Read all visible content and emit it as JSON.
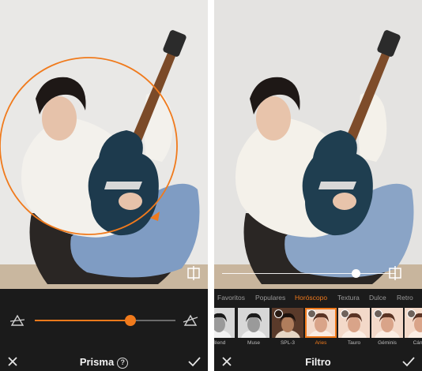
{
  "left_panel": {
    "title": "Prisma",
    "help_glyph": "?",
    "slider_value": 0.68,
    "effect_color": "#f07a1c",
    "icons": [
      "prism-less-icon",
      "prism-more-icon",
      "close-icon",
      "help-icon",
      "check-icon"
    ]
  },
  "right_panel": {
    "title": "Filtro",
    "intensity_value": 0.77,
    "categories": [
      {
        "label": "Favoritos",
        "active": false
      },
      {
        "label": "Populares",
        "active": false
      },
      {
        "label": "Horóscopo",
        "active": true
      },
      {
        "label": "Textura",
        "active": false
      },
      {
        "label": "Dulce",
        "active": false
      },
      {
        "label": "Retro",
        "active": false
      }
    ],
    "filters": [
      {
        "label": "Blend",
        "selected": false,
        "style": "bw"
      },
      {
        "label": "Muse",
        "selected": false,
        "style": "bw"
      },
      {
        "label": "SPL-3",
        "selected": false,
        "style": "dark"
      },
      {
        "label": "Aries",
        "selected": true,
        "style": "warm"
      },
      {
        "label": "Tauro",
        "selected": false,
        "style": "warm"
      },
      {
        "label": "Géminis",
        "selected": false,
        "style": "warm"
      },
      {
        "label": "Cánce",
        "selected": false,
        "style": "warm"
      }
    ],
    "icons": [
      "compare-icon",
      "close-icon",
      "check-icon"
    ]
  },
  "colors": {
    "accent": "#f07a1c",
    "bar_background": "#1b1b1b",
    "photo_background": "#ecebea"
  }
}
